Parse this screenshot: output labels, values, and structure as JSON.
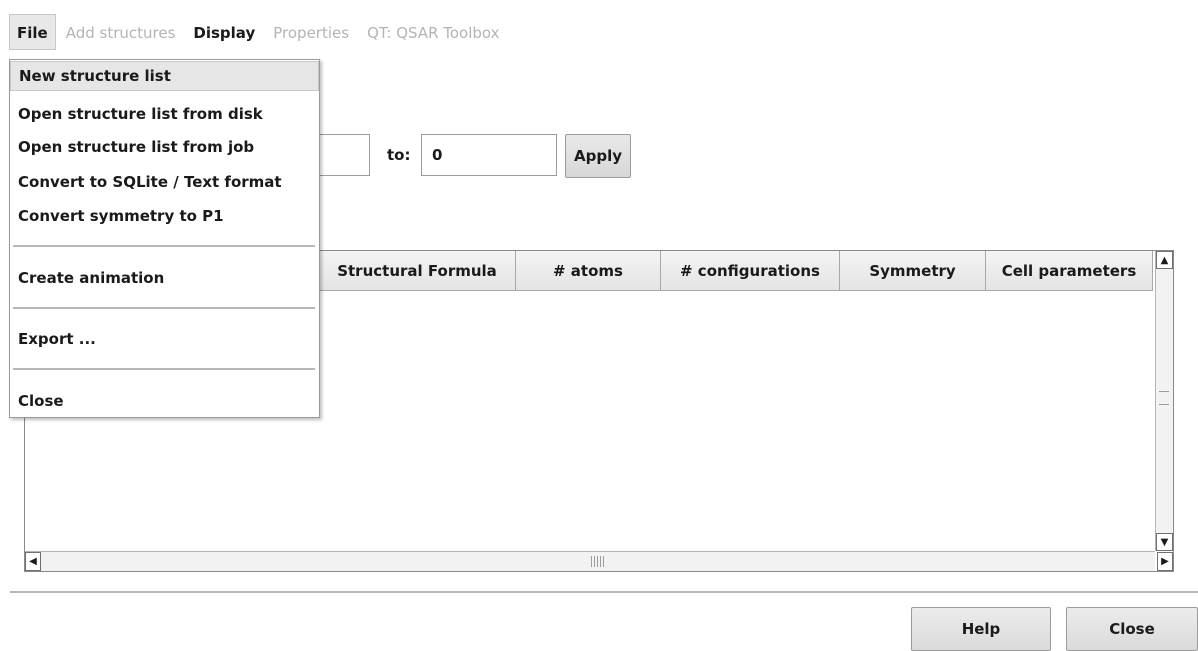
{
  "menubar": {
    "file": "File",
    "add_structures": "Add structures",
    "display": "Display",
    "properties": "Properties",
    "qt": "QT: QSAR Toolbox"
  },
  "range": {
    "from_value": "",
    "to_label": "to:",
    "to_value": "0",
    "apply": "Apply"
  },
  "table": {
    "columns": [
      "Structural Formula",
      "# atoms",
      "# configurations",
      "Symmetry",
      "Cell parameters"
    ]
  },
  "file_menu": {
    "items": [
      "New structure list",
      "Open structure list from disk",
      "Open structure list from job",
      "Convert to SQLite / Text format",
      "Convert symmetry to P1",
      "Create animation",
      "Export ...",
      "Close"
    ]
  },
  "footer": {
    "help": "Help",
    "close": "Close"
  },
  "colors": {
    "disabled_text": "#b4b4b4",
    "menu_highlight": "#e6e6e6"
  }
}
